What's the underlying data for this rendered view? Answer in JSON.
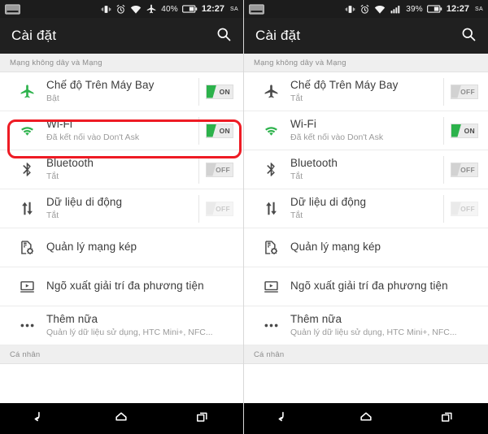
{
  "panels": [
    {
      "id": "left",
      "statusbar": {
        "left_icon": "keyboard-icon",
        "icons": [
          "vibrate-icon",
          "alarm-icon",
          "wifi-icon",
          "airplane-icon"
        ],
        "battery_percent": "40%",
        "battery_icon": "battery-icon",
        "time": "12:27",
        "ampm": "SA"
      },
      "actionbar": {
        "title": "Cài đặt",
        "search_icon": "search-icon"
      },
      "section_header": "Mạng không dây và Mạng",
      "rows": [
        {
          "icon": "airplane-icon",
          "icon_color": "#2cb24b",
          "title": "Chế độ Trên Máy Bay",
          "subtitle": "Bật",
          "toggle": "ON",
          "toggle_state": "on",
          "disabled": false
        },
        {
          "icon": "wifi-icon",
          "icon_color": "#2cb24b",
          "title": "Wi-Fi",
          "subtitle": "Đã kết nối vào Don't Ask",
          "toggle": "ON",
          "toggle_state": "on",
          "disabled": false
        },
        {
          "icon": "bluetooth-icon",
          "icon_color": "#4a4a4a",
          "title": "Bluetooth",
          "subtitle": "Tắt",
          "toggle": "OFF",
          "toggle_state": "off",
          "disabled": false
        },
        {
          "icon": "mobile-data-icon",
          "icon_color": "#4a4a4a",
          "title": "Dữ liệu di động",
          "subtitle": "Tắt",
          "toggle": "OFF",
          "toggle_state": "off",
          "disabled": true
        },
        {
          "icon": "dual-sim-icon",
          "icon_color": "#4a4a4a",
          "title": "Quản lý mạng kép",
          "subtitle": "",
          "toggle": "",
          "toggle_state": "",
          "disabled": false
        },
        {
          "icon": "media-output-icon",
          "icon_color": "#4a4a4a",
          "title": "Ngõ xuất giải trí đa phương tiện",
          "subtitle": "",
          "toggle": "",
          "toggle_state": "",
          "disabled": false
        },
        {
          "icon": "more-icon",
          "icon_color": "#4a4a4a",
          "title": "Thêm nữa",
          "subtitle": "Quản lý dữ liệu sử dụng, HTC Mini+, NFC...",
          "toggle": "",
          "toggle_state": "",
          "disabled": false
        }
      ],
      "section_header_2": "Cá nhân",
      "highlight": {
        "enabled": true,
        "color": "#ee1b24",
        "target": "wifi-row"
      },
      "navbar": {
        "back": "back-icon",
        "home": "home-icon",
        "recents": "recents-icon"
      }
    },
    {
      "id": "right",
      "statusbar": {
        "left_icon": "keyboard-icon",
        "icons": [
          "vibrate-icon",
          "alarm-icon",
          "wifi-icon",
          "signal-bars-icon"
        ],
        "battery_percent": "39%",
        "battery_icon": "battery-icon",
        "time": "12:27",
        "ampm": "SA"
      },
      "actionbar": {
        "title": "Cài đặt",
        "search_icon": "search-icon"
      },
      "section_header": "Mạng không dây và Mạng",
      "rows": [
        {
          "icon": "airplane-icon",
          "icon_color": "#4a4a4a",
          "title": "Chế độ Trên Máy Bay",
          "subtitle": "Tắt",
          "toggle": "OFF",
          "toggle_state": "off",
          "disabled": false
        },
        {
          "icon": "wifi-icon",
          "icon_color": "#2cb24b",
          "title": "Wi-Fi",
          "subtitle": "Đã kết nối vào Don't Ask",
          "toggle": "ON",
          "toggle_state": "on",
          "disabled": false
        },
        {
          "icon": "bluetooth-icon",
          "icon_color": "#4a4a4a",
          "title": "Bluetooth",
          "subtitle": "Tắt",
          "toggle": "OFF",
          "toggle_state": "off",
          "disabled": false
        },
        {
          "icon": "mobile-data-icon",
          "icon_color": "#4a4a4a",
          "title": "Dữ liệu di động",
          "subtitle": "Tắt",
          "toggle": "OFF",
          "toggle_state": "off",
          "disabled": true
        },
        {
          "icon": "dual-sim-icon",
          "icon_color": "#4a4a4a",
          "title": "Quản lý mạng kép",
          "subtitle": "",
          "toggle": "",
          "toggle_state": "",
          "disabled": false
        },
        {
          "icon": "media-output-icon",
          "icon_color": "#4a4a4a",
          "title": "Ngõ xuất giải trí đa phương tiện",
          "subtitle": "",
          "toggle": "",
          "toggle_state": "",
          "disabled": false
        },
        {
          "icon": "more-icon",
          "icon_color": "#4a4a4a",
          "title": "Thêm nữa",
          "subtitle": "Quản lý dữ liệu sử dụng, HTC Mini+, NFC...",
          "toggle": "",
          "toggle_state": "",
          "disabled": false
        }
      ],
      "section_header_2": "Cá nhân",
      "highlight": {
        "enabled": false,
        "color": "#ee1b24",
        "target": ""
      },
      "navbar": {
        "back": "back-icon",
        "home": "home-icon",
        "recents": "recents-icon"
      }
    }
  ]
}
